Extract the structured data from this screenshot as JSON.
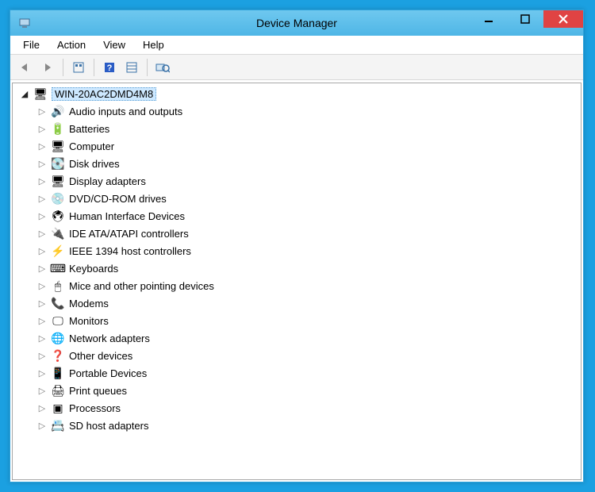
{
  "window": {
    "title": "Device Manager"
  },
  "menu": {
    "items": [
      "File",
      "Action",
      "View",
      "Help"
    ]
  },
  "toolbar": {
    "back": "back-arrow-icon",
    "forward": "forward-arrow-icon",
    "show_hidden": "show-hidden-icon",
    "help": "help-icon",
    "properties": "properties-icon",
    "scan": "scan-hardware-icon"
  },
  "tree": {
    "root": {
      "label": "WIN-20AC2DMD4M8",
      "icon": "computer-icon",
      "expanded": true
    },
    "children": [
      {
        "label": "Audio inputs and outputs",
        "icon": "speaker-icon"
      },
      {
        "label": "Batteries",
        "icon": "battery-icon"
      },
      {
        "label": "Computer",
        "icon": "computer-icon"
      },
      {
        "label": "Disk drives",
        "icon": "disk-icon"
      },
      {
        "label": "Display adapters",
        "icon": "display-icon"
      },
      {
        "label": "DVD/CD-ROM drives",
        "icon": "cdrom-icon"
      },
      {
        "label": "Human Interface Devices",
        "icon": "hid-icon"
      },
      {
        "label": "IDE ATA/ATAPI controllers",
        "icon": "ide-icon"
      },
      {
        "label": "IEEE 1394 host controllers",
        "icon": "firewire-icon"
      },
      {
        "label": "Keyboards",
        "icon": "keyboard-icon"
      },
      {
        "label": "Mice and other pointing devices",
        "icon": "mouse-icon"
      },
      {
        "label": "Modems",
        "icon": "modem-icon"
      },
      {
        "label": "Monitors",
        "icon": "monitor-icon"
      },
      {
        "label": "Network adapters",
        "icon": "network-icon"
      },
      {
        "label": "Other devices",
        "icon": "other-icon"
      },
      {
        "label": "Portable Devices",
        "icon": "portable-icon"
      },
      {
        "label": "Print queues",
        "icon": "printer-icon"
      },
      {
        "label": "Processors",
        "icon": "processor-icon"
      },
      {
        "label": "SD host adapters",
        "icon": "sd-icon"
      }
    ]
  },
  "icon_glyphs": {
    "computer-icon": "🖥",
    "speaker-icon": "🔊",
    "battery-icon": "🔋",
    "disk-icon": "💽",
    "display-icon": "🖥",
    "cdrom-icon": "💿",
    "hid-icon": "🖲",
    "ide-icon": "🔌",
    "firewire-icon": "⚡",
    "keyboard-icon": "⌨",
    "mouse-icon": "🖱",
    "modem-icon": "📞",
    "monitor-icon": "🖵",
    "network-icon": "🌐",
    "other-icon": "❓",
    "portable-icon": "📱",
    "printer-icon": "🖨",
    "processor-icon": "▣",
    "sd-icon": "📇"
  }
}
